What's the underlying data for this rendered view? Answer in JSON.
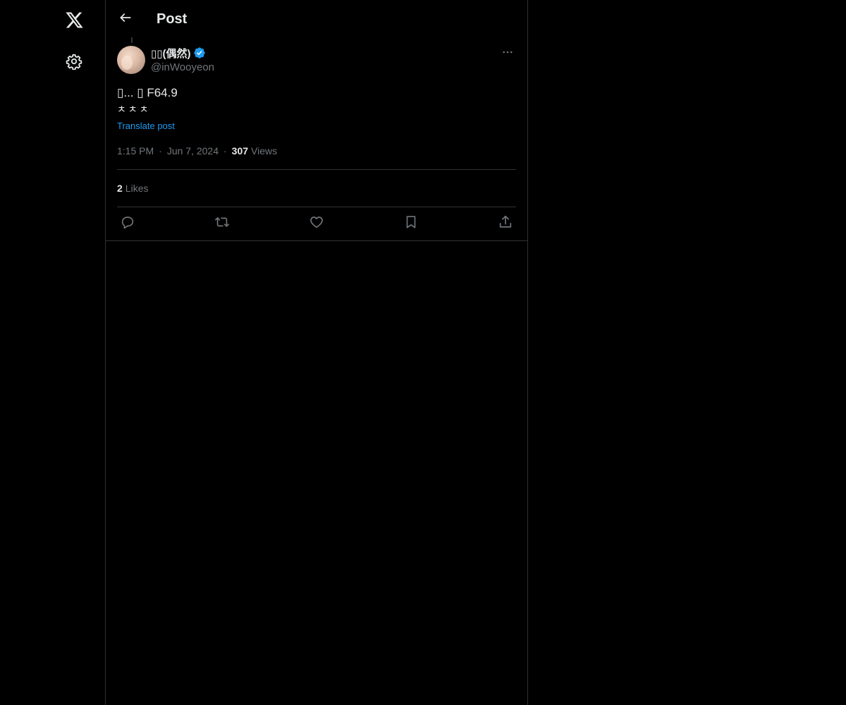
{
  "left_rail": {
    "logo_icon": "x-logo-icon",
    "settings_icon": "gear-icon"
  },
  "header": {
    "title": "Post",
    "back_icon": "arrow-left-icon"
  },
  "post": {
    "author": {
      "display_name": "▯▯(偶然)",
      "handle": "@inWooyeon",
      "verified": true
    },
    "text_line_1": "▯... ▯ F64.9",
    "text_line_2": "ㅊㅊㅊ",
    "translate_label": "Translate post",
    "time": "1:15 PM",
    "date": "Jun 7, 2024",
    "separator": "·",
    "views_count": "307",
    "views_label": "Views",
    "likes_count": "2",
    "likes_label": "Likes",
    "actions": [
      "reply-icon",
      "repost-icon",
      "like-icon",
      "bookmark-icon",
      "share-icon"
    ]
  },
  "colors": {
    "background": "#000000",
    "text_primary": "#e7e9ea",
    "text_secondary": "#71767b",
    "accent": "#1d9bf0",
    "border": "#2f3336"
  }
}
